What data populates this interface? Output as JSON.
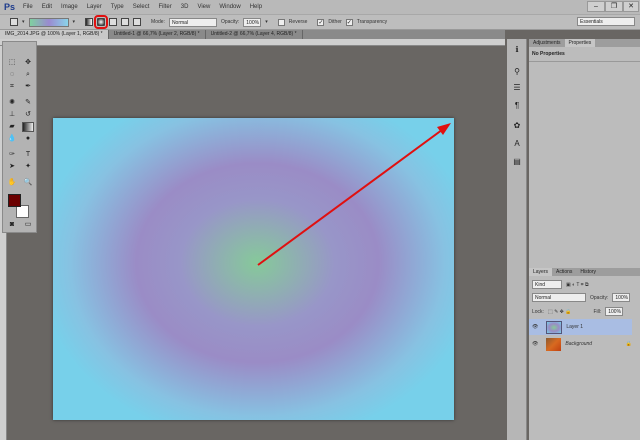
{
  "app": {
    "logo": "Ps",
    "menu": [
      "File",
      "Edit",
      "Image",
      "Layer",
      "Type",
      "Select",
      "Filter",
      "3D",
      "View",
      "Window",
      "Help"
    ],
    "window_controls": [
      "–",
      "❐",
      "✕"
    ]
  },
  "options": {
    "mode_label": "Mode:",
    "mode_value": "Normal",
    "opacity_label": "Opacity:",
    "opacity_value": "100%",
    "reverse_label": "Reverse",
    "dither_label": "Dither",
    "transparency_label": "Transparency",
    "workspace": "Essentials",
    "dither_checked": true,
    "transparency_checked": true,
    "reverse_checked": false,
    "selected_gradient_type": "radial"
  },
  "tabs": [
    {
      "label": "IMG_2014.JPG @ 100% (Layer 1, RGB/8) *",
      "active": true
    },
    {
      "label": "Untitled-1 @ 66,7% (Layer 2, RGB/8) *"
    },
    {
      "label": "Untitled-2 @ 66,7% (Layer 4, RGB/8) *"
    }
  ],
  "colors": {
    "foreground": "#6b0000",
    "background": "#ffffff",
    "annotation": "#e01010"
  },
  "properties": {
    "tabs": [
      "Adjustments",
      "Properties"
    ],
    "content": "No Properties"
  },
  "layers": {
    "tabs": [
      "Layers",
      "Actions",
      "History"
    ],
    "filter": "Kind",
    "blend": "Normal",
    "opacity_label": "Opacity:",
    "opacity": "100%",
    "lock_label": "Lock:",
    "fill_label": "Fill:",
    "fill": "100%",
    "items": [
      {
        "name": "Layer 1",
        "selected": true
      },
      {
        "name": "Background",
        "locked": true
      }
    ]
  }
}
